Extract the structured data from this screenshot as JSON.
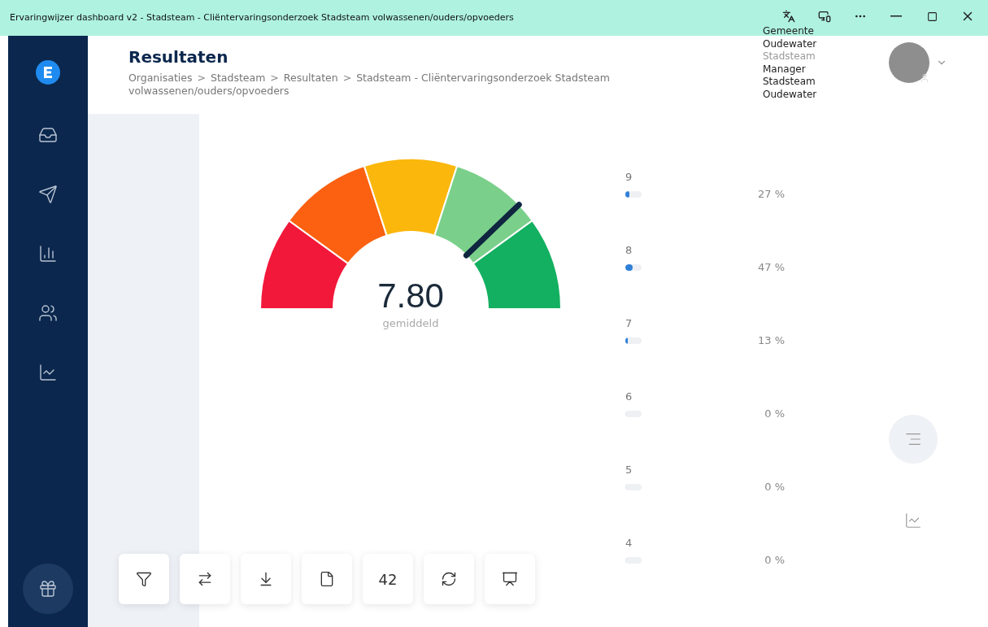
{
  "window": {
    "title": "Ervaringwijzer dashboard v2 - Stadsteam - Cliëntervaringsonderzoek Stadsteam volwassenen/ouders/opvoeders"
  },
  "sidebar": {
    "items": [
      {
        "kind": "inbox",
        "selected": false
      },
      {
        "kind": "send",
        "selected": false
      },
      {
        "kind": "bars",
        "selected": false
      },
      {
        "kind": "people",
        "selected": false
      },
      {
        "kind": "chart",
        "selected": false
      }
    ]
  },
  "header": {
    "title": "Resultaten",
    "breadcrumb": [
      "Organisaties",
      "Stadsteam",
      "Resultaten",
      "Stadsteam - Cliëntervaringsonderzoek Stadsteam volwassenen/ouders/opvoeders"
    ],
    "separator": ">"
  },
  "user": {
    "lines": [
      {
        "text": "Gemeente",
        "muted": false
      },
      {
        "text": "Oudewater",
        "muted": false
      },
      {
        "text": "Stadsteam",
        "muted": true
      },
      {
        "text": "Manager",
        "muted": false
      },
      {
        "text": "Stadsteam",
        "muted": false
      },
      {
        "text": "Oudewater",
        "muted": false
      }
    ]
  },
  "gauge": {
    "value": "7.80",
    "label": "gemiddeld",
    "level": 0.756
  },
  "distribution": [
    {
      "score": "9",
      "level": 0.27,
      "percent": "27 %"
    },
    {
      "score": "8",
      "level": 0.47,
      "percent": "47 %"
    },
    {
      "score": "7",
      "level": 0.13,
      "percent": "13 %"
    },
    {
      "score": "6",
      "level": 0,
      "percent": "0 %"
    },
    {
      "score": "5",
      "level": 0,
      "percent": "0 %"
    },
    {
      "score": "4",
      "level": 0,
      "percent": "0 %"
    }
  ],
  "view_toggle": [
    {
      "kind": "list",
      "selected": true
    },
    {
      "kind": "chart",
      "selected": false
    }
  ],
  "toolbar": [
    {
      "kind": "filter"
    },
    {
      "kind": "swap"
    },
    {
      "kind": "download"
    },
    {
      "kind": "file"
    },
    {
      "kind": "count",
      "text": "42"
    },
    {
      "kind": "refresh"
    },
    {
      "kind": "presentation"
    }
  ]
}
